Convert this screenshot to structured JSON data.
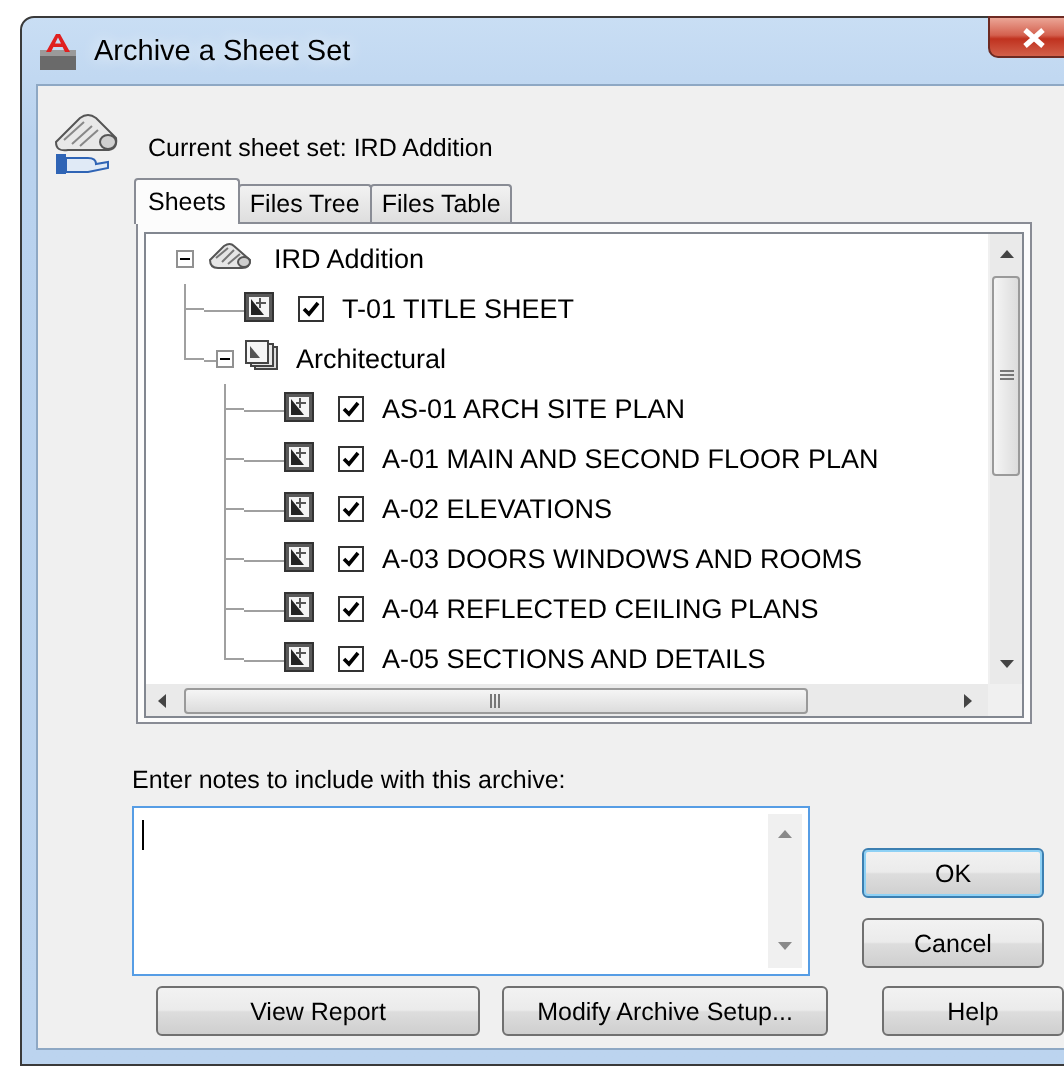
{
  "window": {
    "title": "Archive a Sheet Set"
  },
  "current_sheet_set": "Current sheet set: IRD Addition",
  "tabs": [
    {
      "label": "Sheets",
      "selected": true
    },
    {
      "label": "Files Tree",
      "selected": false
    },
    {
      "label": "Files Table",
      "selected": false
    }
  ],
  "tree": [
    {
      "label": "IRD Addition",
      "kind": "set",
      "expanded": true,
      "children": [
        {
          "label": "T-01 TITLE SHEET",
          "kind": "sheet",
          "checked": true
        },
        {
          "label": "Architectural",
          "kind": "subset",
          "expanded": true,
          "children": [
            {
              "label": "AS-01 ARCH SITE PLAN",
              "kind": "sheet",
              "checked": true
            },
            {
              "label": "A-01 MAIN AND SECOND FLOOR PLAN",
              "kind": "sheet",
              "checked": true
            },
            {
              "label": "A-02 ELEVATIONS",
              "kind": "sheet",
              "checked": true
            },
            {
              "label": "A-03 DOORS WINDOWS AND ROOMS",
              "kind": "sheet",
              "checked": true
            },
            {
              "label": "A-04 REFLECTED CEILING PLANS",
              "kind": "sheet",
              "checked": true
            },
            {
              "label": "A-05 SECTIONS AND DETAILS",
              "kind": "sheet",
              "checked": true
            }
          ]
        }
      ]
    }
  ],
  "notes": {
    "label": "Enter notes to include with this archive:",
    "focused": true
  },
  "side_buttons": [
    {
      "label": "OK",
      "default": true
    },
    {
      "label": "Cancel",
      "default": false
    }
  ],
  "bottom_buttons": [
    {
      "label": "View Report"
    },
    {
      "label": "Modify Archive Setup..."
    },
    {
      "label": "Help"
    }
  ]
}
